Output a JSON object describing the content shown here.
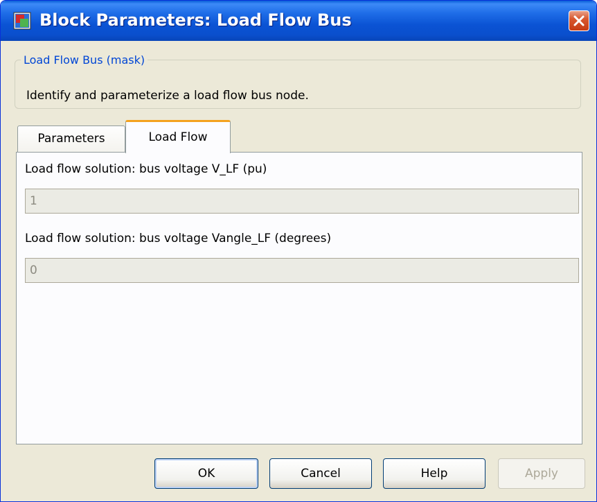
{
  "window": {
    "title": "Block Parameters: Load Flow Bus",
    "icon": "simulink-block-icon",
    "close": "close-icon"
  },
  "mask": {
    "legend": "Load Flow Bus (mask)",
    "description": "Identify and parameterize a load flow bus node."
  },
  "tabs": [
    {
      "label": "Parameters",
      "active": false
    },
    {
      "label": "Load Flow",
      "active": true
    }
  ],
  "fields": [
    {
      "label": "Load flow solution:  bus voltage V_LF (pu)",
      "value": "1"
    },
    {
      "label": "Load flow solution:  bus voltage Vangle_LF (degrees)",
      "value": "0"
    }
  ],
  "buttons": {
    "ok": "OK",
    "cancel": "Cancel",
    "help": "Help",
    "apply": "Apply"
  },
  "colors": {
    "titlebar": "#0b53d4",
    "close": "#c63b14",
    "tab_accent": "#f4a21e",
    "legend_text": "#0046d5"
  }
}
